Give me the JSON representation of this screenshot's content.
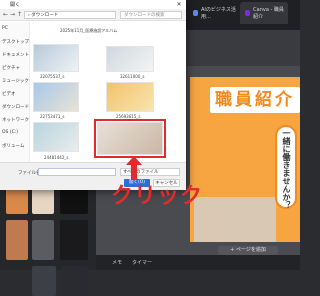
{
  "browser_tabs": [
    {
      "label": "AIのビジネス活用…",
      "color": "#5b8def"
    },
    {
      "label": "Canva - 職員紹介",
      "color": "#7d2ae8"
    },
    {
      "label": "",
      "color": "#2ecc71"
    }
  ],
  "dialog": {
    "title": "開く",
    "close_glyph": "✕",
    "address": "› ダウンロード",
    "search_placeholder": "ダウンロードの検索",
    "sidebar": [
      "PC",
      "デスクトップ",
      "ドキュメント",
      "ピクチャ",
      "ミュージック",
      "ビデオ",
      "ダウンロード",
      "ネットワーク",
      "OS (C:)",
      "ボリューム"
    ],
    "header_caption": "2025年11月_医療施設アルバム",
    "files": [
      {
        "label": "22075537_s",
        "colors": [
          "#b7c9d9",
          "#eef2f6"
        ]
      },
      {
        "label": "32611000_s",
        "colors": [
          "#cfd8df",
          "#f4f4f2"
        ]
      },
      {
        "label": "22753471_s",
        "colors": [
          "#a7c8e8",
          "#e9e2d6"
        ]
      },
      {
        "label": "25693615_s",
        "colors": [
          "#f2c46a",
          "#f8e3b0"
        ]
      },
      {
        "label": "24481442_s",
        "colors": [
          "#b9d4df",
          "#e8ecec"
        ]
      },
      {
        "label": "",
        "colors": [
          "#e7e0d8",
          "#cab7a5"
        ]
      }
    ],
    "filename_label": "ファイル名(N):",
    "filetype_value": "すべてのファイル",
    "open_label": "開く(O)",
    "cancel_label": "キャンセル"
  },
  "annotation": {
    "click_label": "クリック",
    "color": "#e22b2b"
  },
  "editor": {
    "poster_title": "職員紹介",
    "poster_vertical": "一緒に働きませんか？",
    "add_page_label": "+ ページを追加",
    "bottom_memo": "メモ",
    "bottom_timer": "タイマー",
    "poster_color": "#f7a541"
  }
}
